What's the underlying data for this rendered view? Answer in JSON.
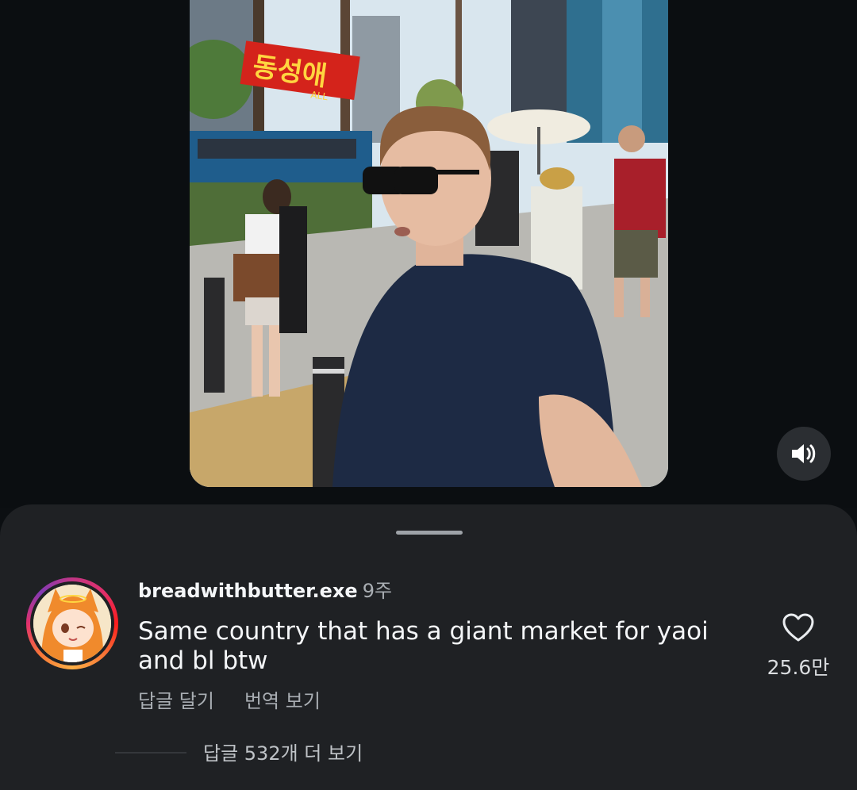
{
  "video": {
    "banner_text": "동성애",
    "banner_subtext": "ALL",
    "sound_icon": "speaker-on-icon"
  },
  "comment": {
    "username": "breadwithbutter.exe",
    "time": "9주",
    "text": "Same country that has a giant market for yaoi and bl btw",
    "reply_label": "답글 달기",
    "translate_label": "번역 보기",
    "like_icon": "heart-outline-icon",
    "like_count": "25.6만"
  },
  "replies": {
    "view_more_label": "답글 532개 더 보기"
  },
  "colors": {
    "background": "#0c0f12",
    "sheet": "#1f2124",
    "secondary_text": "#a9aeb3",
    "avatar_ring": "#e1306c"
  }
}
